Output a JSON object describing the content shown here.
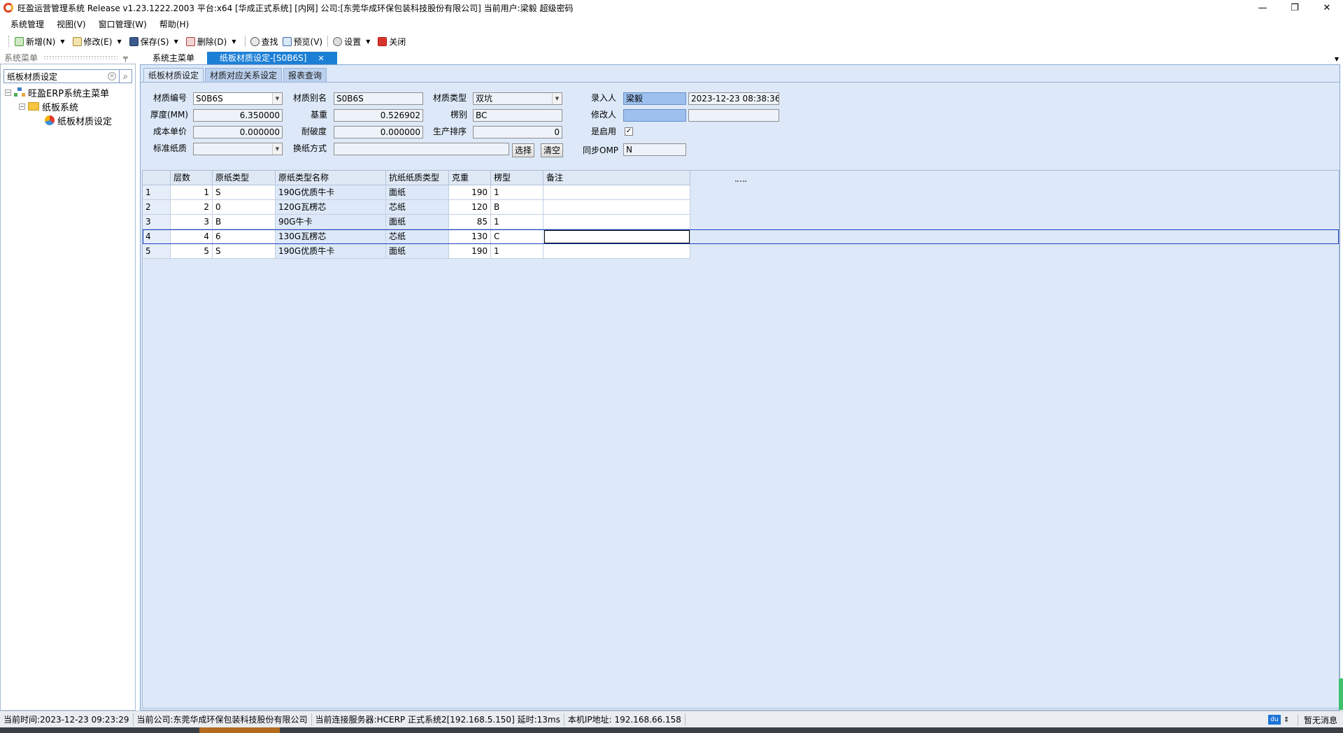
{
  "window": {
    "title": "旺盈运营管理系统 Release v1.23.1222.2003 平台:x64  [华成正式系统] [内网] 公司:[东莞华成环保包装科技股份有限公司] 当前用户:梁毅  超级密码",
    "controls": {
      "minimize": "—",
      "restore": "❐",
      "close": "✕"
    }
  },
  "menu": [
    "系统管理",
    "视图(V)",
    "窗口管理(W)",
    "帮助(H)"
  ],
  "toolbar": {
    "new": "新增(N)",
    "edit": "修改(E)",
    "save": "保存(S)",
    "delete": "删除(D)",
    "find": "查找",
    "preview": "预览(V)",
    "settings": "设置",
    "close": "关闭"
  },
  "left_panel": {
    "header": "系统菜单",
    "search_value": "纸板材质设定",
    "tree": {
      "root": "旺盈ERP系统主菜单",
      "child": "纸板系统",
      "leaf": "纸板材质设定"
    }
  },
  "doc_tabs": {
    "home": "系统主菜单",
    "active": "纸板材质设定-[S0B6S]"
  },
  "sub_tabs": [
    "纸板材质设定",
    "材质对应关系设定",
    "报表查询"
  ],
  "form": {
    "labels": {
      "code": "材质编号",
      "alias": "材质别名",
      "type": "材质类型",
      "creator": "录入人",
      "thickness": "厚度(MM)",
      "basis_weight": "基重",
      "flute": "楞别",
      "modifier": "修改人",
      "unit_cost": "成本单价",
      "burst": "耐破度",
      "sort": "生产排序",
      "enabled": "是启用",
      "std_paper": "标准纸质",
      "swap_method": "换纸方式",
      "sync_omp": "同步OMP"
    },
    "values": {
      "code": "S0B6S",
      "alias": "S0B6S",
      "type": "双坑",
      "creator": "梁毅",
      "created_at": "2023-12-23 08:38:36",
      "thickness": "6.350000",
      "basis_weight": "0.526902",
      "flute": "BC",
      "modifier": "",
      "modified_at": "",
      "unit_cost": "0.000000",
      "burst": "0.000000",
      "sort": "0",
      "enabled": "✓",
      "std_paper": "",
      "swap_method": "",
      "sync_omp": "N"
    },
    "buttons": {
      "select": "选择",
      "clear": "清空"
    }
  },
  "grid": {
    "headers": [
      "",
      "层数",
      "原纸类型",
      "原纸类型名称",
      "抗纸纸质类型",
      "克重",
      "楞型",
      "备注"
    ],
    "rows": [
      [
        "1",
        "1",
        "S",
        "190G优质牛卡",
        "面纸",
        "190",
        "1",
        ""
      ],
      [
        "2",
        "2",
        "0",
        "120G瓦楞芯",
        "芯纸",
        "120",
        "B",
        ""
      ],
      [
        "3",
        "3",
        "B",
        "90G牛卡",
        "面纸",
        "85",
        "1",
        ""
      ],
      [
        "4",
        "4",
        "6",
        "130G瓦楞芯",
        "芯纸",
        "130",
        "C",
        ""
      ],
      [
        "5",
        "5",
        "S",
        "190G优质牛卡",
        "面纸",
        "190",
        "1",
        ""
      ]
    ],
    "selected_row": 4
  },
  "status": {
    "time": "当前时间:2023-12-23 09:23:29",
    "company": "当前公司:东莞华成环保包装科技股份有限公司",
    "server": "当前连接服务器:HCERP 正式系统2[192.168.5.150] 延时:13ms",
    "ip": "本机IP地址: 192.168.66.158",
    "du": "du",
    "message": "暂无消息"
  }
}
